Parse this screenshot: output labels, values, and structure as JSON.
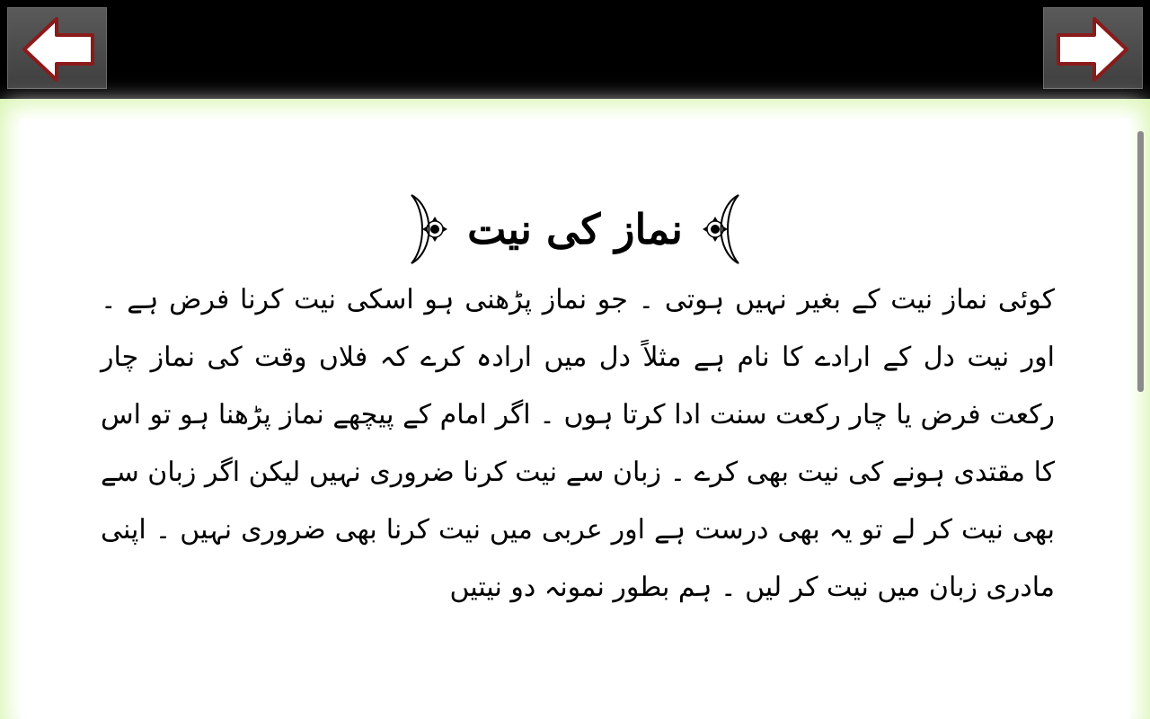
{
  "nav": {
    "prev_icon": "arrow-left-icon",
    "next_icon": "arrow-right-icon"
  },
  "article": {
    "title": "نماز کی نیت",
    "body": "کوئی نماز نیت کے بغیر نہیں ہوتی ۔ جو نماز پڑھنی ہو اسکی نیت کرنا فرض ہے ۔ اور نیت دل کے ارادے کا نام ہے مثلاً دل میں ارادہ کرے کہ فلاں وقت کی نماز چار رکعت فرض یا چار رکعت سنت ادا کرتا ہوں ۔ اگر امام کے پیچھے نماز پڑھنا ہو تو اس کا مقتدی ہونے کی نیت بھی کرے ۔ زبان سے نیت کرنا ضروری نہیں لیکن اگر زبان سے بھی نیت کر لے تو یہ بھی درست ہے اور عربی میں نیت کرنا بھی ضروری نہیں ۔ اپنی مادری زبان میں نیت کر لیں ۔ ہم بطور نمونہ دو نیتیں"
  },
  "colors": {
    "frame": "#d8f5b0",
    "arrow_fill": "#ffffff",
    "arrow_stroke": "#8b1a1a"
  }
}
